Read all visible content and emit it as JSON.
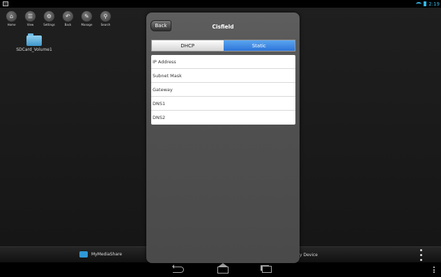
{
  "status_bar": {
    "time": "2:19"
  },
  "toolbar": [
    {
      "label": "Home",
      "glyph": "⌂"
    },
    {
      "label": "View",
      "glyph": "☰"
    },
    {
      "label": "Settings",
      "glyph": "⚙"
    },
    {
      "label": "Back",
      "glyph": "↶"
    },
    {
      "label": "Manage",
      "glyph": "✎"
    },
    {
      "label": "Search",
      "glyph": "⚲"
    }
  ],
  "desktop": {
    "folder_label": "SDCard_Volume1"
  },
  "bottom_bar": {
    "share_label": "MyMediaShare",
    "device_label": "y Device"
  },
  "dialog": {
    "back_label": "Back",
    "title": "Cisfield",
    "tabs": [
      {
        "label": "DHCP",
        "selected": false
      },
      {
        "label": "Static",
        "selected": true
      }
    ],
    "fields": [
      {
        "label": "IP Address"
      },
      {
        "label": "Subnet Mask"
      },
      {
        "label": "Gateway"
      },
      {
        "label": "DNS1"
      },
      {
        "label": "DNS2"
      }
    ]
  },
  "colors": {
    "accent": "#2d74d8",
    "status": "#33b5e5"
  }
}
